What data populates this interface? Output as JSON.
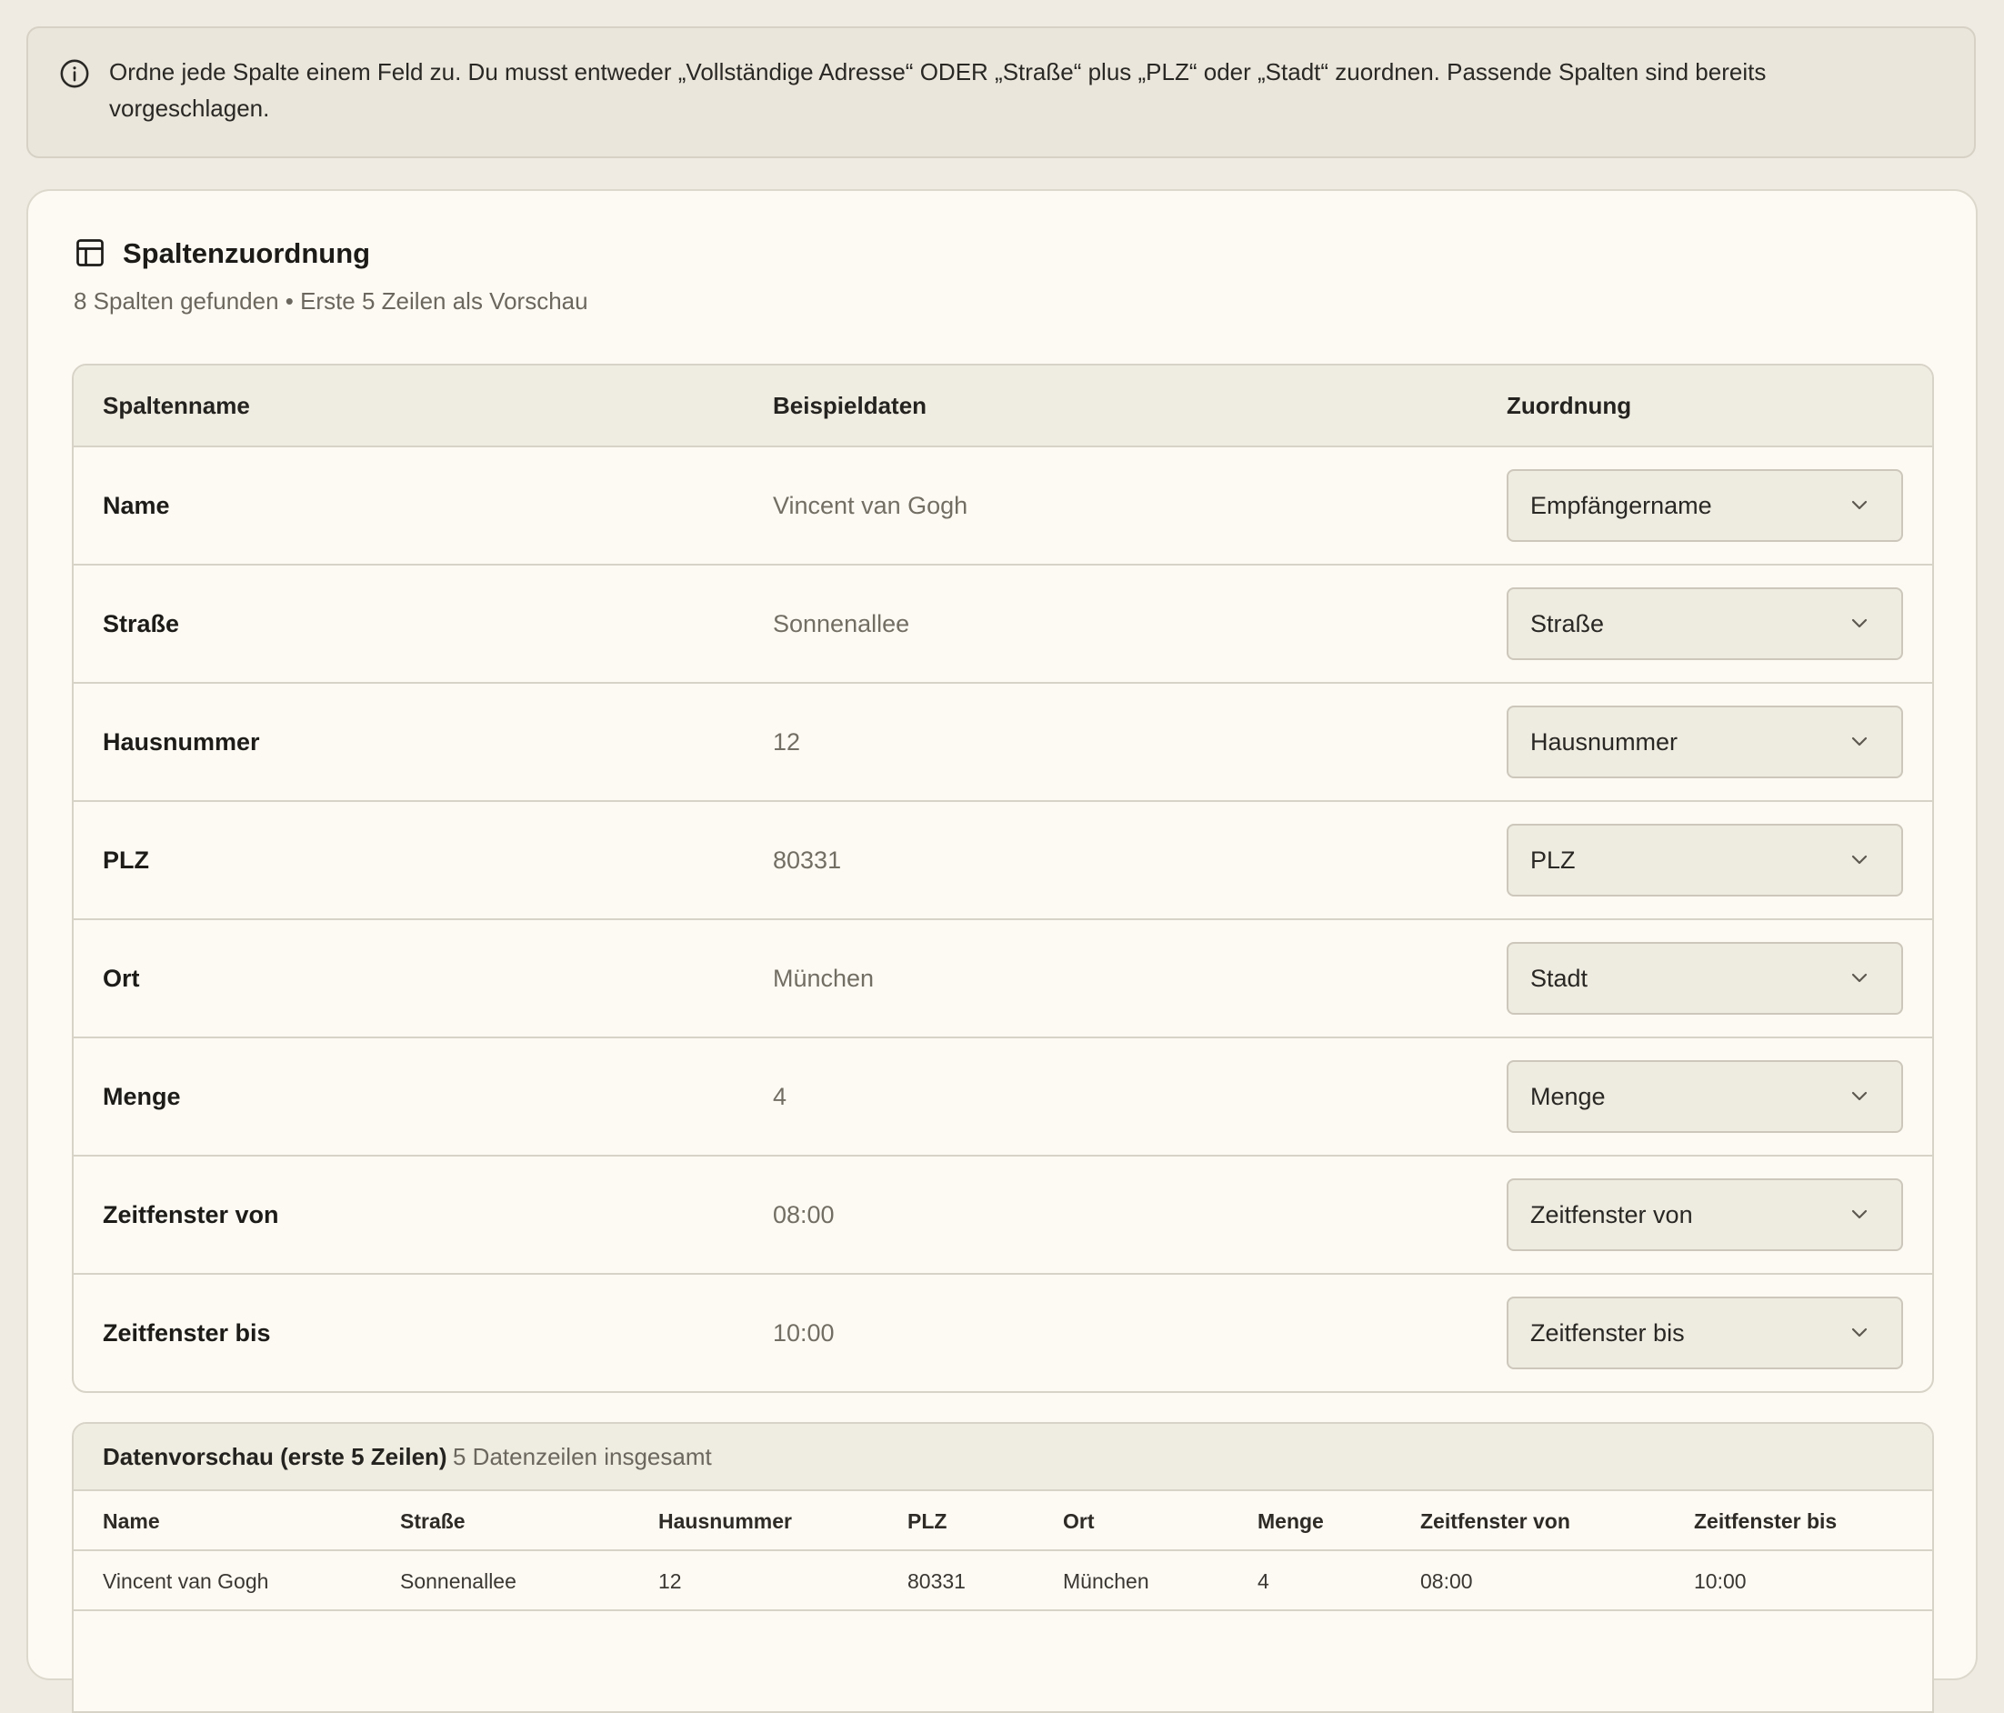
{
  "info": {
    "icon": "info-icon",
    "text": "Ordne jede Spalte einem Feld zu. Du musst entweder „Vollständige Adresse“ ODER „Straße“ plus „PLZ“ oder „Stadt“ zuordnen. Passende Spalten sind bereits vorgeschlagen."
  },
  "card": {
    "icon": "table-icon",
    "title": "Spaltenzuordnung",
    "subtitle": "8 Spalten gefunden • Erste 5 Zeilen als Vorschau"
  },
  "mapping": {
    "headers": {
      "name": "Spaltenname",
      "sample": "Beispieldaten",
      "assign": "Zuordnung"
    },
    "rows": [
      {
        "name": "Name",
        "sample": "Vincent van Gogh",
        "assignment": "Empfängername"
      },
      {
        "name": "Straße",
        "sample": "Sonnenallee",
        "assignment": "Straße"
      },
      {
        "name": "Hausnummer",
        "sample": "12",
        "assignment": "Hausnummer"
      },
      {
        "name": "PLZ",
        "sample": "80331",
        "assignment": "PLZ"
      },
      {
        "name": "Ort",
        "sample": "München",
        "assignment": "Stadt"
      },
      {
        "name": "Menge",
        "sample": "4",
        "assignment": "Menge"
      },
      {
        "name": "Zeitfenster von",
        "sample": "08:00",
        "assignment": "Zeitfenster von"
      },
      {
        "name": "Zeitfenster bis",
        "sample": "10:00",
        "assignment": "Zeitfenster bis"
      }
    ]
  },
  "preview": {
    "title": "Datenvorschau (erste 5 Zeilen)",
    "count": "5 Datenzeilen insgesamt",
    "columns": [
      "Name",
      "Straße",
      "Hausnummer",
      "PLZ",
      "Ort",
      "Menge",
      "Zeitfenster von",
      "Zeitfenster bis"
    ],
    "rows": [
      [
        "Vincent van Gogh",
        "Sonnenallee",
        "12",
        "80331",
        "München",
        "4",
        "08:00",
        "10:00"
      ]
    ]
  },
  "colors": {
    "background": "#efebe2",
    "card": "#fcfaf3",
    "border": "#d8d3c7",
    "muted_text": "#736e64"
  }
}
